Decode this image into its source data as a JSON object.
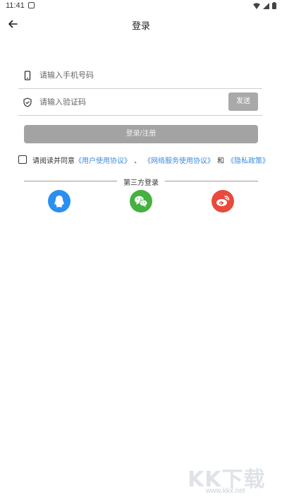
{
  "status_bar": {
    "time": "11:41"
  },
  "header": {
    "title": "登录",
    "back_icon": "arrow-left-icon"
  },
  "phone_field": {
    "placeholder": "请输入手机号码",
    "icon": "phone-icon"
  },
  "code_field": {
    "placeholder": "请输入验证码",
    "icon": "shield-check-icon",
    "send_button": "发送"
  },
  "login_button": "登录/注册",
  "agreement": {
    "prefix": "请阅读并同意",
    "link1": "《用户使用协议》",
    "sep1": "、",
    "link2": "《网络服务使用协议》",
    "sep2": "和",
    "link3": "《隐私政策》",
    "checked": false
  },
  "third_party": {
    "title": "第三方登录",
    "providers": [
      {
        "name": "qq",
        "icon": "qq-icon",
        "color": "#2a8ff0"
      },
      {
        "name": "wechat",
        "icon": "wechat-icon",
        "color": "#46b041"
      },
      {
        "name": "weibo",
        "icon": "weibo-icon",
        "color": "#e84a3c"
      }
    ]
  },
  "watermark": {
    "main": "KK下载",
    "sub": "www.kkx.net"
  },
  "colors": {
    "link": "#3d8be0",
    "disabled_button": "#a3a3a3"
  }
}
